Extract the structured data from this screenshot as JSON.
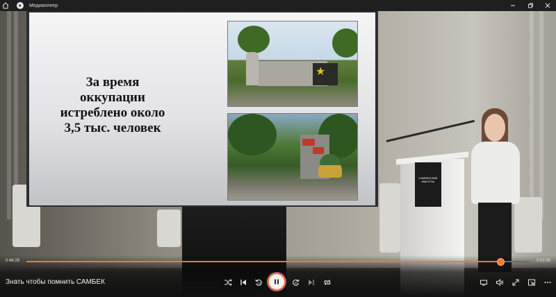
{
  "titlebar": {
    "home_icon": "home-icon",
    "app_icon": "media-player-icon",
    "title": "Медиаплеер",
    "controls": [
      "minimize-icon",
      "restore-icon",
      "close-icon"
    ]
  },
  "slide": {
    "text_lines": [
      "За время",
      "оккупации",
      "истреблено около",
      "3,5 тыс. человек"
    ]
  },
  "podium": {
    "logo_text": "САМБЕКСКИЕ ВЫСОТЫ"
  },
  "player": {
    "elapsed": "0:46:29",
    "remaining": "0:02:56",
    "progress_fraction": 0.9407,
    "media_title": "Знать чтобы помнить САМБЕК",
    "accent_color": "#f27a2b",
    "buttons": {
      "shuffle": "shuffle-icon",
      "previous": "previous-icon",
      "rewind_10": "rewind-10-icon",
      "play_pause": "pause-icon",
      "forward_30": "forward-30-icon",
      "next": "next-icon",
      "repeat": "repeat-icon",
      "cast": "cast-icon",
      "volume": "volume-icon",
      "fullscreen": "fullscreen-icon",
      "mini_view": "mini-view-icon",
      "more": "more-icon"
    }
  }
}
